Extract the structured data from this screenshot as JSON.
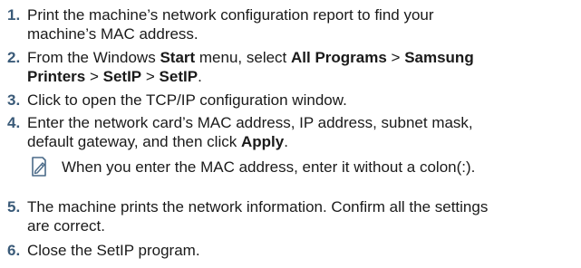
{
  "steps": [
    {
      "num": "1.",
      "lines": [
        "Print the machine’s network configuration report to find your",
        "machine’s MAC address."
      ]
    },
    {
      "num": "2.",
      "l1_a": "From the Windows ",
      "l1_b": "Start",
      "l1_c": " menu, select ",
      "l1_d": "All Programs",
      "l1_e": " > ",
      "l1_f": "Samsung",
      "l2_a": "Printers",
      "l2_b": " > ",
      "l2_c": "SetIP",
      "l2_d": " > ",
      "l2_e": "SetIP",
      "l2_f": "."
    },
    {
      "num": "3.",
      "lines": [
        "Click to open the TCP/IP configuration window."
      ]
    },
    {
      "num": "4.",
      "line1": "Enter the network card’s MAC address, IP address, subnet mask,",
      "line2_a": "default gateway, and then click ",
      "line2_b": "Apply",
      "line2_c": "."
    },
    {
      "num": "5.",
      "lines": [
        "The machine prints the network information. Confirm all the settings",
        "are correct."
      ]
    },
    {
      "num": "6.",
      "lines": [
        "Close the SetIP program."
      ]
    }
  ],
  "note": {
    "icon": "note-pencil-icon",
    "text": "When you enter the MAC address, enter it without a colon(:)."
  },
  "colors": {
    "step_number": "#3a5a78",
    "text": "#1a1a1a",
    "icon": "#4a6a88"
  }
}
